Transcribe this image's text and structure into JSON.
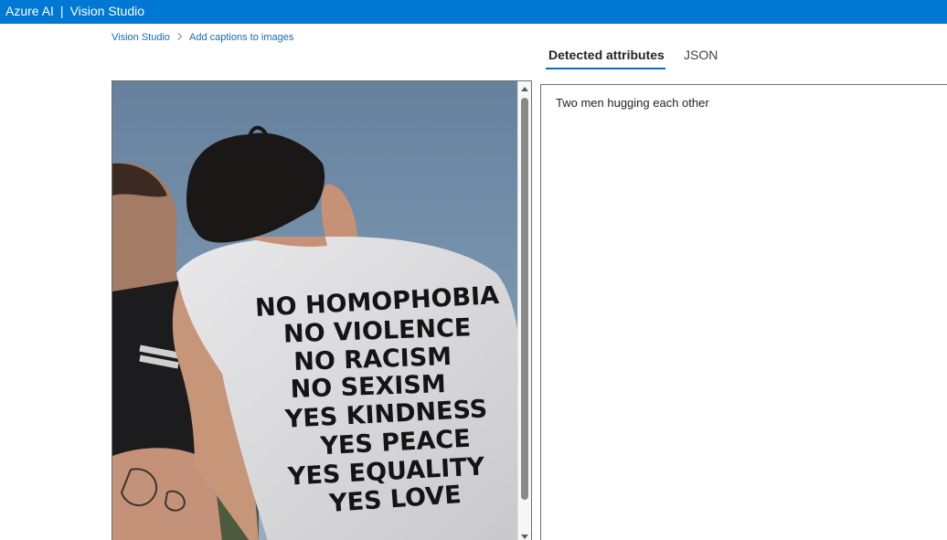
{
  "header": {
    "product": "Azure AI",
    "separator": "|",
    "app": "Vision Studio"
  },
  "breadcrumb": {
    "items": [
      "Vision Studio",
      "Add captions to images"
    ]
  },
  "tabs": [
    {
      "label": "Detected attributes",
      "selected": true
    },
    {
      "label": "JSON",
      "selected": false
    }
  ],
  "image": {
    "shirt_text": [
      "NO HOMOPHOBIA",
      "NO VIOLENCE",
      "NO RACISM",
      "NO SEXISM",
      "YES KINDNESS",
      "YES PEACE",
      "YES EQUALITY",
      "YES LOVE"
    ]
  },
  "results": {
    "caption": "Two men hugging each other"
  },
  "colors": {
    "accent": "#0078d4",
    "link": "#0f6cbd"
  }
}
